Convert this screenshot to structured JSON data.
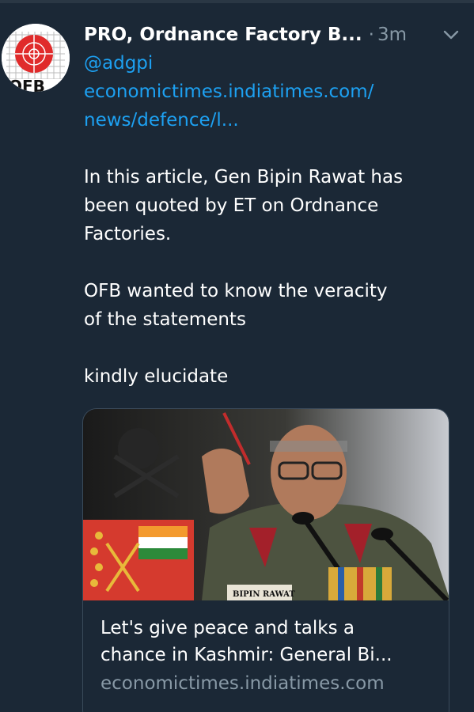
{
  "tweet": {
    "display_name": "PRO, Ordnance Factory B...",
    "separator": "·",
    "timestamp": "3m",
    "mention": "@adgpi",
    "link_line1": "economictimes.indiatimes.com/",
    "link_line2": "news/defence/l...",
    "paragraph1": [
      "In this article, Gen Bipin Rawat has",
      "been quoted by ET on Ordnance",
      "Factories."
    ],
    "paragraph2": [
      "OFB wanted to know the veracity",
      "of the statements"
    ],
    "paragraph3": [
      "kindly elucidate"
    ]
  },
  "avatar": {
    "logo_text": "OFB"
  },
  "card": {
    "title_line1": "Let's give peace and talks a",
    "title_line2": "chance in Kashmir: General Bi...",
    "domain": "economictimes.indiatimes.com",
    "nameplate": "BIPIN RAWAT"
  },
  "icons": {
    "menu": "chevron-down-icon"
  },
  "colors": {
    "background": "#1b2836",
    "link": "#1da1f2",
    "muted": "#8899a6",
    "text": "#ffffff"
  }
}
